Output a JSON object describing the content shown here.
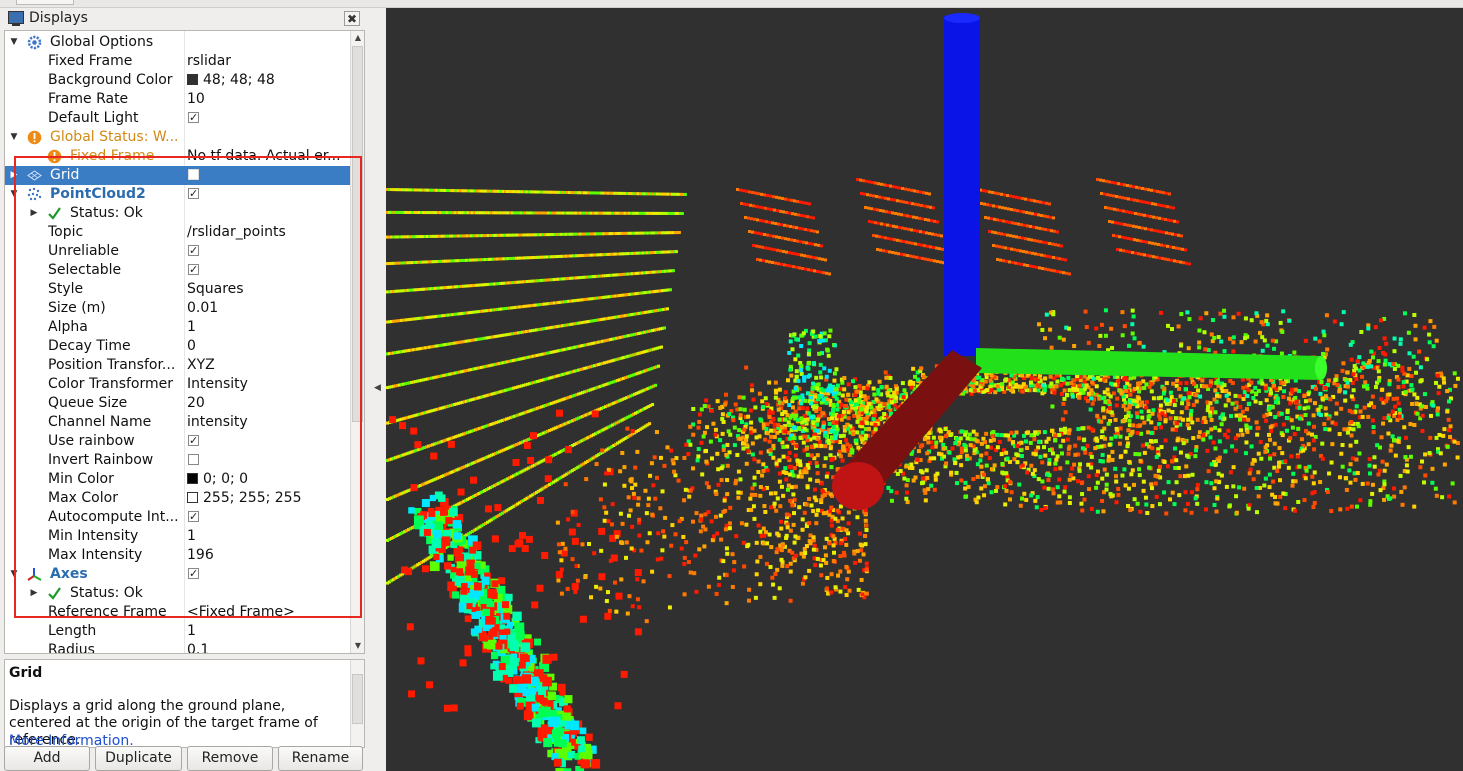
{
  "panel": {
    "title": "Displays",
    "close_glyph": "✖"
  },
  "tree": {
    "rows": [
      {
        "name": "Global Options",
        "value": "",
        "arrow": "down",
        "icon": "gear-icon",
        "indent": 0,
        "style": "normal"
      },
      {
        "name": "Fixed Frame",
        "value": "rslidar",
        "indent": 2
      },
      {
        "name": "Background Color",
        "value": "48; 48; 48",
        "swatch": "#303030",
        "indent": 2
      },
      {
        "name": "Frame Rate",
        "value": "10",
        "indent": 2
      },
      {
        "name": "Default Light",
        "value": "",
        "check": true,
        "indent": 2
      },
      {
        "name": "Global Status: W...",
        "value": "",
        "arrow": "down",
        "icon": "warning-icon",
        "indent": 0,
        "style": "warn"
      },
      {
        "name": "Fixed Frame",
        "value": "No tf data.  Actual er...",
        "icon": "warning-icon",
        "indent": 1,
        "style": "warn"
      },
      {
        "name": "Grid",
        "value": "",
        "arrow": "right",
        "icon": "grid-icon",
        "indent": 0,
        "check": false,
        "selected": true
      },
      {
        "name": "PointCloud2",
        "value": "",
        "arrow": "down",
        "icon": "pointcloud-icon",
        "indent": 0,
        "style": "bold",
        "check": true
      },
      {
        "name": "Status: Ok",
        "value": "",
        "arrow": "right",
        "icon": "checkmark-icon",
        "indent": 1
      },
      {
        "name": "Topic",
        "value": "/rslidar_points",
        "indent": 2
      },
      {
        "name": "Unreliable",
        "value": "",
        "check": true,
        "indent": 2
      },
      {
        "name": "Selectable",
        "value": "",
        "check": true,
        "indent": 2
      },
      {
        "name": "Style",
        "value": "Squares",
        "indent": 2
      },
      {
        "name": "Size (m)",
        "value": "0.01",
        "indent": 2
      },
      {
        "name": "Alpha",
        "value": "1",
        "indent": 2
      },
      {
        "name": "Decay Time",
        "value": "0",
        "indent": 2
      },
      {
        "name": "Position Transfor...",
        "value": "XYZ",
        "indent": 2
      },
      {
        "name": "Color Transformer",
        "value": "Intensity",
        "indent": 2
      },
      {
        "name": "Queue Size",
        "value": "20",
        "indent": 2
      },
      {
        "name": "Channel Name",
        "value": "intensity",
        "indent": 2
      },
      {
        "name": "Use rainbow",
        "value": "",
        "check": true,
        "indent": 2
      },
      {
        "name": "Invert Rainbow",
        "value": "",
        "check": false,
        "indent": 2
      },
      {
        "name": "Min Color",
        "value": "0; 0; 0",
        "swatch": "#000000",
        "indent": 2
      },
      {
        "name": "Max Color",
        "value": "255; 255; 255",
        "swatch": "#ffffff",
        "indent": 2
      },
      {
        "name": "Autocompute Int...",
        "value": "",
        "check": true,
        "indent": 2
      },
      {
        "name": "Min Intensity",
        "value": "1",
        "indent": 2
      },
      {
        "name": "Max Intensity",
        "value": "196",
        "indent": 2
      },
      {
        "name": "Axes",
        "value": "",
        "arrow": "down",
        "icon": "axes-icon",
        "indent": 0,
        "style": "bold",
        "check": true
      },
      {
        "name": "Status: Ok",
        "value": "",
        "arrow": "right",
        "icon": "checkmark-icon",
        "indent": 1
      },
      {
        "name": "Reference Frame",
        "value": "<Fixed Frame>",
        "indent": 2
      },
      {
        "name": "Length",
        "value": "1",
        "indent": 2
      },
      {
        "name": "Radius",
        "value": "0.1",
        "indent": 2
      }
    ]
  },
  "description": {
    "title": "Grid",
    "text": "Displays a grid along the ground plane, centered at the origin of the target frame of reference.",
    "link": "More Information."
  },
  "buttons": {
    "add": "Add",
    "duplicate": "Duplicate",
    "remove": "Remove",
    "rename": "Rename"
  },
  "colors": {
    "selection": "#3b7dc4",
    "highlight_box": "#e8281e",
    "viewport_bg": "#303030",
    "axis_z": "#0a14e6",
    "axis_x": "#c01414",
    "axis_y": "#22e01a"
  }
}
